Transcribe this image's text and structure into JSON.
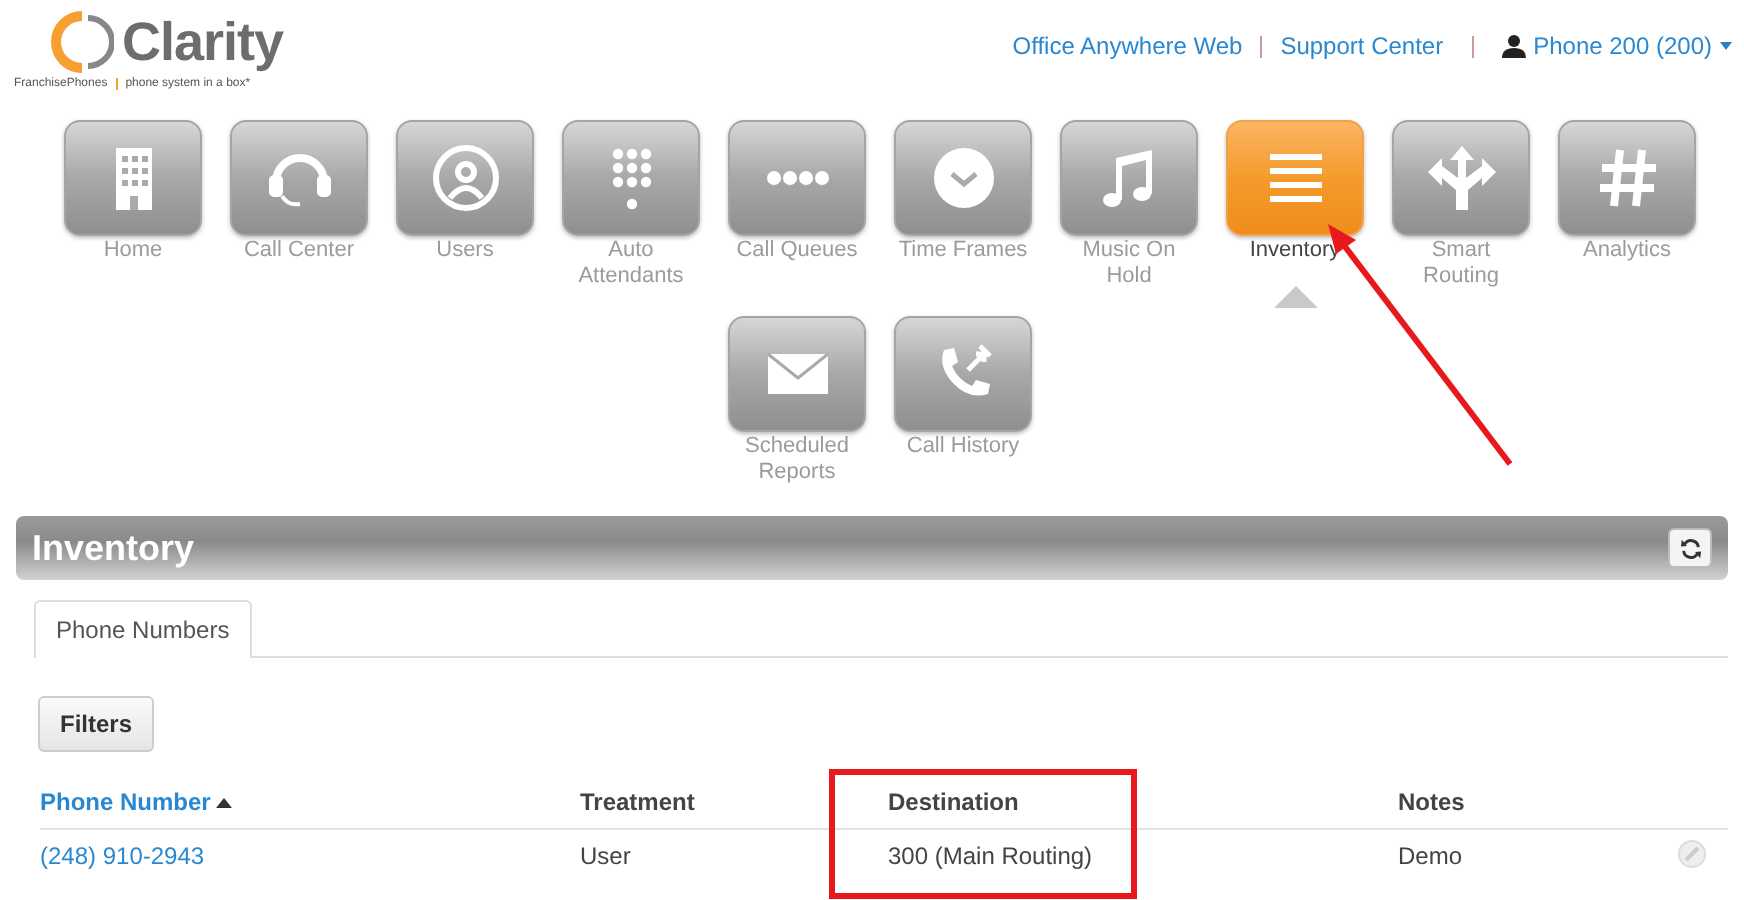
{
  "logo": {
    "name": "Clarity",
    "brand": "FranchisePhones",
    "tagline": "phone system in a box*"
  },
  "header_links": [
    {
      "label": "Office Anywhere Web"
    },
    {
      "label": "Support Center"
    }
  ],
  "user_menu": {
    "label": "Phone 200 (200)"
  },
  "nav_rows": [
    [
      {
        "label": "Home",
        "kind": "building",
        "selected": false
      },
      {
        "label": "Call Center",
        "kind": "headset",
        "selected": false
      },
      {
        "label": "Users",
        "kind": "users",
        "selected": false
      },
      {
        "label": "Auto Attendants",
        "kind": "keypad",
        "selected": false
      },
      {
        "label": "Call Queues",
        "kind": "dots",
        "selected": false
      },
      {
        "label": "Time Frames",
        "kind": "clock",
        "selected": false
      },
      {
        "label": "Music On Hold",
        "kind": "music",
        "selected": false
      },
      {
        "label": "Inventory",
        "kind": "list",
        "selected": true
      },
      {
        "label": "Smart Routing",
        "kind": "split",
        "selected": false
      },
      {
        "label": "Analytics",
        "kind": "hash",
        "selected": false
      }
    ],
    [
      {
        "label": "Scheduled Reports",
        "kind": "mail",
        "selected": false
      },
      {
        "label": "Call History",
        "kind": "phone",
        "selected": false
      }
    ]
  ],
  "panel": {
    "title": "Inventory"
  },
  "tabs": [
    {
      "label": "Phone Numbers",
      "selected": true
    }
  ],
  "filters_button": "Filters",
  "table": {
    "columns": [
      {
        "label": "Phone Number",
        "sorted": true
      },
      {
        "label": "Treatment",
        "sorted": false
      },
      {
        "label": "Destination",
        "sorted": false
      },
      {
        "label": "Notes",
        "sorted": false
      }
    ],
    "rows": [
      {
        "cells": [
          "(248) 910-2943",
          "User",
          "300 (Main Routing)",
          "Demo"
        ]
      }
    ]
  }
}
